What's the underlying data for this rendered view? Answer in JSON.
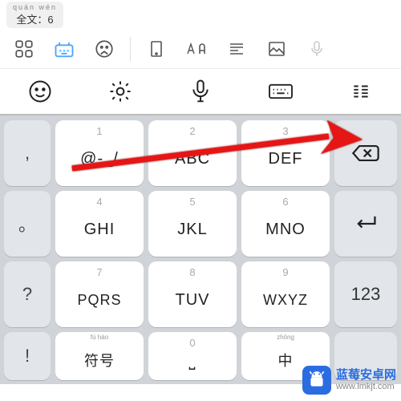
{
  "candidate": {
    "pinyin": "quán wén",
    "text": "全文：6"
  },
  "toolbar1": {
    "icons": [
      "grid-icon",
      "ime-icon",
      "face-icon",
      "tablet-icon",
      "font-icon",
      "align-icon",
      "image-icon",
      "mic-icon"
    ]
  },
  "toolbar2": {
    "icons": [
      "emoji-icon",
      "settings-icon",
      "voice-icon",
      "keyboard-icon",
      "lines-icon"
    ]
  },
  "keys": {
    "side": [
      ",",
      "。",
      "?",
      "!"
    ],
    "grid": [
      {
        "n": "1",
        "m": "@-_/"
      },
      {
        "n": "2",
        "m": "ABC"
      },
      {
        "n": "3",
        "m": "DEF"
      },
      {
        "n": "4",
        "m": "GHI"
      },
      {
        "n": "5",
        "m": "JKL"
      },
      {
        "n": "6",
        "m": "MNO"
      },
      {
        "n": "7",
        "m": "PQRS"
      },
      {
        "n": "8",
        "m": "TUV"
      },
      {
        "n": "9",
        "m": "WXYZ"
      }
    ],
    "right": {
      "backspace": "⌫",
      "enter": "↵",
      "num": "123"
    },
    "bottom": {
      "symbol_pinyin": "fú hào",
      "symbol": "符号",
      "zero": "0",
      "zero_sub": "⎵",
      "zh_pinyin": "zhōng",
      "zh": "中"
    }
  },
  "watermark": {
    "cn": "蓝莓安卓网",
    "url": "www.lmkjt.com"
  }
}
